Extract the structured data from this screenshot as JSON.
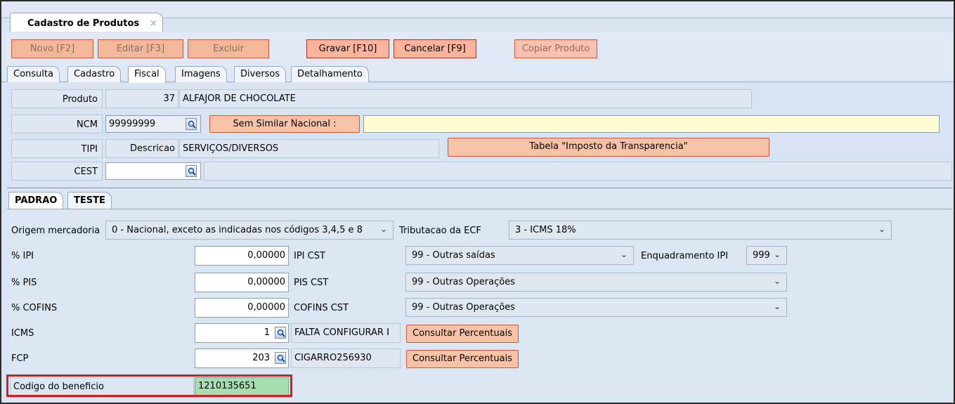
{
  "window": {
    "tab_title": "Cadastro de Produtos",
    "tab_close": "×"
  },
  "toolbar": {
    "novo": "Novo [F2]",
    "editar": "Editar [F3]",
    "excluir": "Excluir",
    "gravar": "Gravar [F10]",
    "cancelar": "Cancelar [F9]",
    "copiar": "Copiar Produto"
  },
  "form_tabs": [
    "Consulta",
    "Cadastro",
    "Fiscal",
    "Imagens",
    "Diversos",
    "Detalhamento"
  ],
  "form": {
    "produto_label": "Produto",
    "produto_code": "37",
    "produto_name": "ALFAJOR DE CHOCOLATE",
    "ncm_label": "NCM",
    "ncm_value": "99999999",
    "sem_similar": "Sem Similar Nacional :",
    "ncm_desc": "",
    "tipi_label": "TIPI",
    "descricao_label": "Descricao",
    "tipi_desc": "SERVIÇOS/DIVERSOS",
    "tabela_btn": "Tabela \"Imposto da Transparencia\"",
    "cest_label": "CEST",
    "cest_value": ""
  },
  "sub_tabs": [
    "PADRAO",
    "TESTE"
  ],
  "fiscal": {
    "origem_label": "Origem mercadoria",
    "origem_value": "0 - Nacional, exceto as indicadas nos códigos 3,4,5 e 8",
    "trib_ecf_label": "Tributacao da ECF",
    "trib_ecf_value": "3  - ICMS 18%",
    "ipi_label": "% IPI",
    "ipi_value": "0,00000",
    "ipi_cst_label": "IPI CST",
    "ipi_cst_value": "99 - Outras saídas",
    "enq_ipi_label": "Enquadramento IPI",
    "enq_ipi_value": "999",
    "pis_label": "% PIS",
    "pis_value": "0,00000",
    "pis_cst_label": "PIS CST",
    "pis_cst_value": "99 - Outras Operações",
    "cofins_label": "% COFINS",
    "cofins_value": "0,00000",
    "cofins_cst_label": "COFINS CST",
    "cofins_cst_value": "99 - Outras Operações",
    "icms_label": "ICMS",
    "icms_value": "1",
    "icms_desc": "FALTA CONFIGURAR I",
    "consultar1": "Consultar Percentuais",
    "fcp_label": "FCP",
    "fcp_value": "203",
    "fcp_desc": "CIGARRO256930",
    "consultar2": "Consultar Percentuais",
    "beneficio_label": "Codigo do beneficio",
    "beneficio_value": "1210135651"
  },
  "icons": {
    "lookup": "magnifier-icon",
    "dropdown": "chevron-down-icon",
    "close": "close-icon"
  }
}
